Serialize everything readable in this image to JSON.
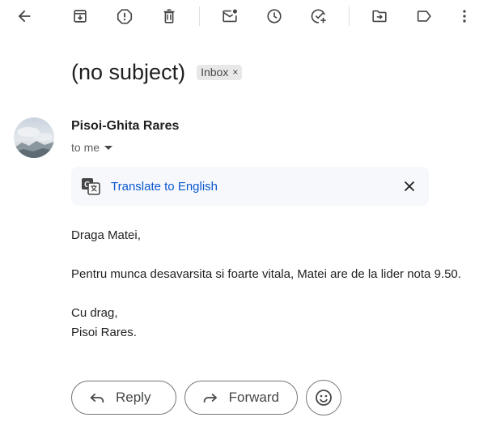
{
  "toolbar": {
    "items": [
      {
        "name": "back",
        "icon": "arrow-left-icon"
      },
      {
        "name": "archive",
        "icon": "archive-icon"
      },
      {
        "name": "report-spam",
        "icon": "report-spam-icon"
      },
      {
        "name": "delete",
        "icon": "trash-icon"
      },
      {
        "name": "mark-unread",
        "icon": "mark-unread-icon"
      },
      {
        "name": "snooze",
        "icon": "clock-icon"
      },
      {
        "name": "add-to-tasks",
        "icon": "add-task-icon"
      },
      {
        "name": "move-to",
        "icon": "move-to-folder-icon"
      },
      {
        "name": "labels",
        "icon": "label-icon"
      },
      {
        "name": "more",
        "icon": "more-vert-icon"
      }
    ]
  },
  "email": {
    "subject": "(no subject)",
    "label": "Inbox",
    "label_remove": "×",
    "sender_name": "Pisoi-Ghita Rares",
    "recipient": "to me",
    "translate_text": "Translate to English",
    "body": {
      "greeting": "Draga Matei,",
      "paragraph": "Pentru munca desavarsita si foarte vitala, Matei are de la lider nota 9.50.",
      "closing": "Cu drag,",
      "signature": "Pisoi Rares."
    }
  },
  "actions": {
    "reply_label": "Reply",
    "forward_label": "Forward"
  },
  "colors": {
    "accent": "#0b57d0",
    "icon": "#444746",
    "translate_bg": "#f6f8fc",
    "chip_bg": "#e8e8e8"
  }
}
